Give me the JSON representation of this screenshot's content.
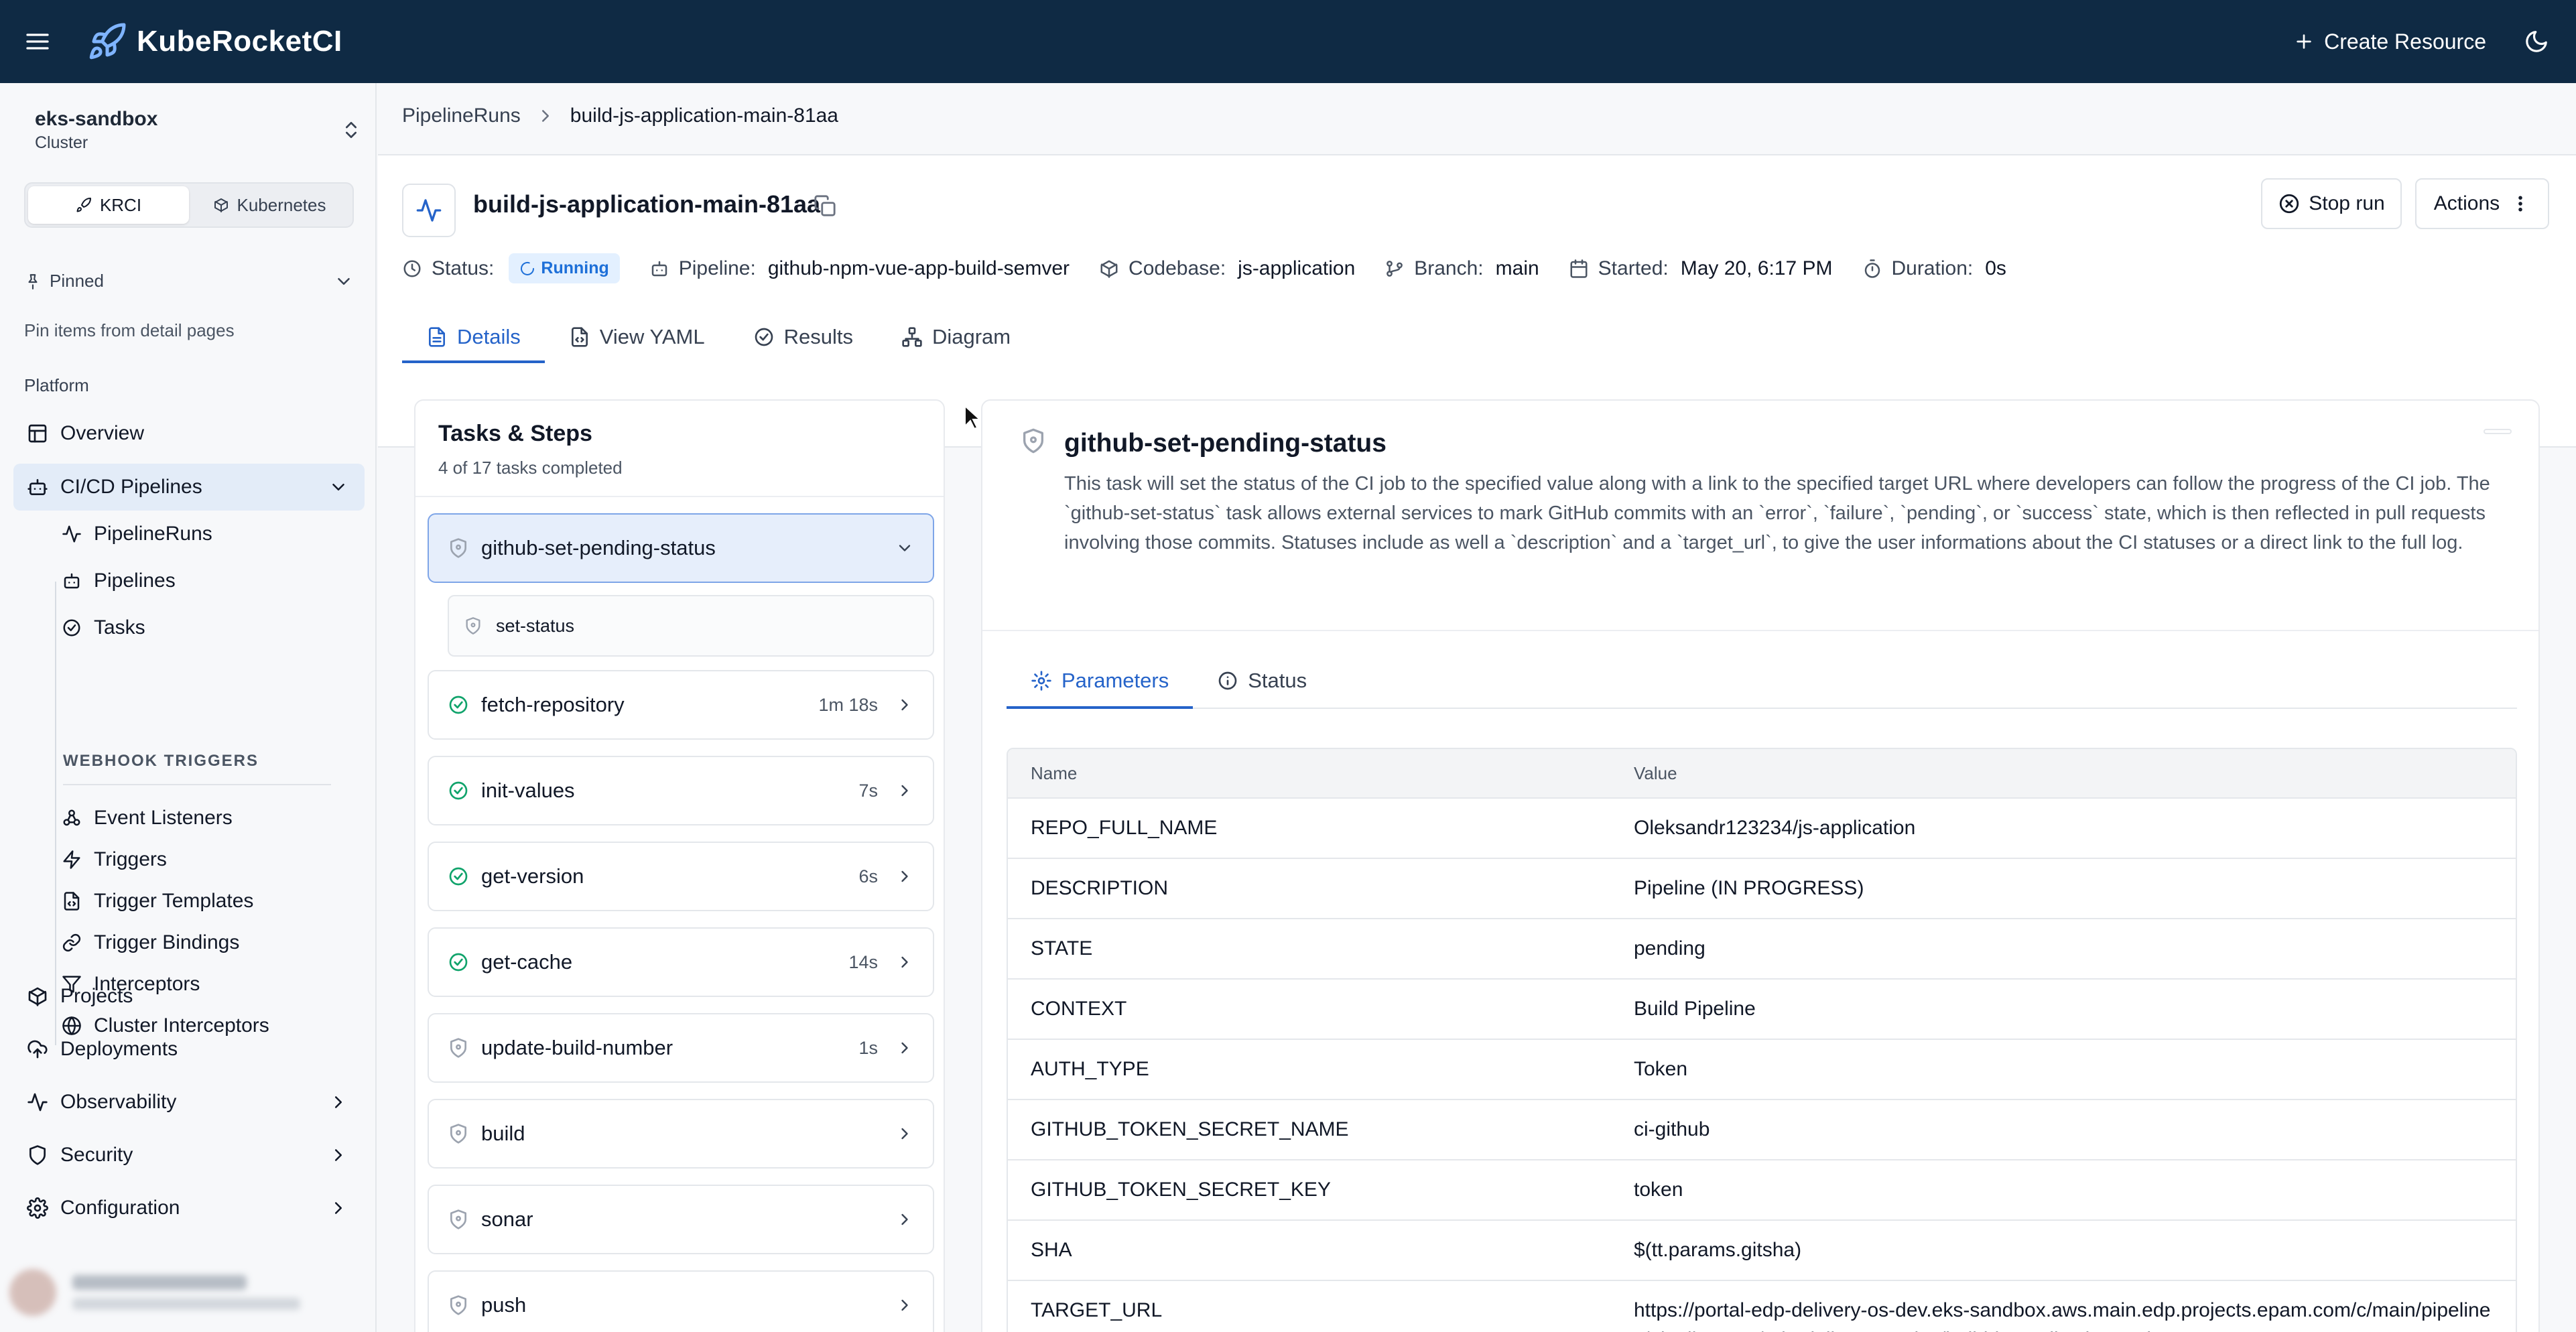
{
  "app": {
    "name": "KubeRocketCI",
    "create_resource": "Create Resource"
  },
  "sidebar": {
    "cluster_name": "eks-sandbox",
    "cluster_type": "Cluster",
    "mode_switch": [
      "KRCI",
      "Kubernetes"
    ],
    "pinned_label": "Pinned",
    "pinned_hint": "Pin items from detail pages",
    "platform_label": "Platform",
    "items": {
      "overview": "Overview",
      "cicd": "CI/CD Pipelines",
      "pipelineruns": "PipelineRuns",
      "pipelines": "Pipelines",
      "tasks": "Tasks",
      "webhook_triggers": "WEBHOOK TRIGGERS",
      "event_listeners": "Event Listeners",
      "triggers": "Triggers",
      "trigger_templates": "Trigger Templates",
      "trigger_bindings": "Trigger Bindings",
      "interceptors": "Interceptors",
      "cluster_interceptors": "Cluster Interceptors",
      "projects": "Projects",
      "deployments": "Deployments",
      "observability": "Observability",
      "security": "Security",
      "configuration": "Configuration"
    }
  },
  "breadcrumb": {
    "parent": "PipelineRuns",
    "current": "build-js-application-main-81aa"
  },
  "run": {
    "title": "build-js-application-main-81aa",
    "stop_label": "Stop run",
    "actions_label": "Actions",
    "status_label": "Status:",
    "status_value": "Running",
    "pipeline_label": "Pipeline:",
    "pipeline_value": "github-npm-vue-app-build-semver",
    "codebase_label": "Codebase:",
    "codebase_value": "js-application",
    "branch_label": "Branch:",
    "branch_value": "main",
    "started_label": "Started:",
    "started_value": "May 20, 6:17 PM",
    "duration_label": "Duration:",
    "duration_value": "0s"
  },
  "tabs": [
    "Details",
    "View YAML",
    "Results",
    "Diagram"
  ],
  "tasks_panel": {
    "title": "Tasks & Steps",
    "subtitle": "4 of 17 tasks completed",
    "tasks": [
      {
        "name": "github-set-pending-status",
        "duration": "",
        "status": "pending"
      },
      {
        "name": "fetch-repository",
        "duration": "1m 18s",
        "status": "succeeded"
      },
      {
        "name": "init-values",
        "duration": "7s",
        "status": "succeeded"
      },
      {
        "name": "get-version",
        "duration": "6s",
        "status": "succeeded"
      },
      {
        "name": "get-cache",
        "duration": "14s",
        "status": "succeeded"
      },
      {
        "name": "update-build-number",
        "duration": "1s",
        "status": "pending"
      },
      {
        "name": "build",
        "duration": "",
        "status": "pending"
      },
      {
        "name": "sonar",
        "duration": "",
        "status": "pending"
      },
      {
        "name": "push",
        "duration": "",
        "status": "pending"
      }
    ],
    "step": "set-status"
  },
  "detail": {
    "title": "github-set-pending-status",
    "description": "This task will set the status of the CI job to the specified value along with a link to the specified target URL where developers can follow the progress of the CI job. The `github-set-status` task allows external services to mark GitHub commits with an `error`, `failure`, `pending`, or `success` state, which is then reflected in pull requests involving those commits. Statuses include as well a `description` and a `target_url`, to give the user informations about the CI statuses or a direct link to the full log.",
    "tabs": [
      "Parameters",
      "Status"
    ],
    "table_headers": [
      "Name",
      "Value"
    ],
    "params": [
      {
        "name": "REPO_FULL_NAME",
        "value": "Oleksandr123234/js-application"
      },
      {
        "name": "DESCRIPTION",
        "value": "Pipeline (IN PROGRESS)"
      },
      {
        "name": "STATE",
        "value": "pending"
      },
      {
        "name": "CONTEXT",
        "value": "Build Pipeline"
      },
      {
        "name": "AUTH_TYPE",
        "value": "Token"
      },
      {
        "name": "GITHUB_TOKEN_SECRET_NAME",
        "value": "ci-github"
      },
      {
        "name": "GITHUB_TOKEN_SECRET_KEY",
        "value": "token"
      },
      {
        "name": "SHA",
        "value": "$(tt.params.gitsha)"
      },
      {
        "name": "TARGET_URL",
        "value": "https://portal-edp-delivery-os-dev.eks-sandbox.aws.main.edp.projects.epam.com/c/main/pipelines/pipelineruns/edp-delivery-os-dev/build-js-application-main-81aa"
      }
    ]
  },
  "colors": {
    "topbar": "#0f2a44",
    "accent": "#2563c9",
    "success": "#10a36b",
    "running_badge_bg": "#e3f0ff"
  }
}
